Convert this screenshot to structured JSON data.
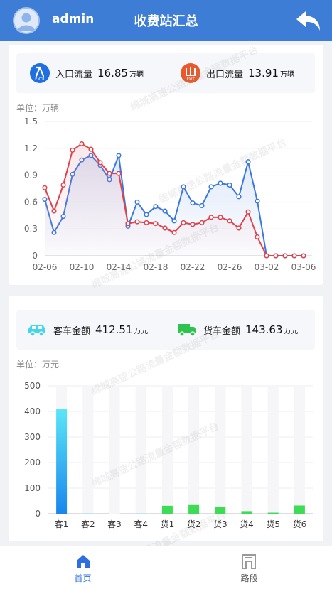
{
  "header": {
    "username": "admin",
    "title": "收费站汇总"
  },
  "watermark": "绵城高速公路流量金额数据平台",
  "traffic": {
    "entry_icon_text": "ENTR",
    "exit_icon_text": "EXIT",
    "entry_label": "入口流量",
    "entry_value": "16.85",
    "entry_unit": "万辆",
    "exit_label": "出口流量",
    "exit_value": "13.91",
    "exit_unit": "万辆",
    "unit_label": "单位：万辆",
    "accent_blue": "#3a78e0",
    "accent_red": "#e0414b"
  },
  "amount": {
    "car_label": "客车金额",
    "car_value": "412.51",
    "car_unit": "万元",
    "truck_label": "货车金额",
    "truck_value": "143.63",
    "truck_unit": "万元",
    "unit_label": "单位：万元"
  },
  "chart_data": [
    {
      "type": "line",
      "x": [
        "02-06",
        "02-07",
        "02-08",
        "02-09",
        "02-10",
        "02-11",
        "02-12",
        "02-13",
        "02-14",
        "02-15",
        "02-16",
        "02-17",
        "02-18",
        "02-19",
        "02-20",
        "02-21",
        "02-22",
        "02-23",
        "02-24",
        "02-25",
        "02-26",
        "02-27",
        "02-28",
        "03-01",
        "03-02",
        "03-03",
        "03-04",
        "03-05",
        "03-06"
      ],
      "x_ticks": [
        "02-06",
        "02-10",
        "02-14",
        "02-18",
        "02-22",
        "02-26",
        "03-02",
        "03-06"
      ],
      "y_ticks": [
        "0",
        "0.3",
        "0.6",
        "0.9",
        "1.2",
        "1.5"
      ],
      "ylim": [
        0,
        1.5
      ],
      "grid": true,
      "series": [
        {
          "color": "#3a78e0",
          "values": [
            0.63,
            0.26,
            0.44,
            0.91,
            1.07,
            1.12,
            1.01,
            0.85,
            1.12,
            0.33,
            0.6,
            0.46,
            0.55,
            0.5,
            0.39,
            0.77,
            0.59,
            0.56,
            0.77,
            0.81,
            0.79,
            0.66,
            1.05,
            0.61,
            0,
            0,
            0,
            0,
            0
          ]
        },
        {
          "color": "#e0414b",
          "values": [
            0.76,
            0.5,
            0.79,
            1.18,
            1.25,
            1.19,
            1.04,
            0.92,
            0.92,
            0.36,
            0.38,
            0.37,
            0.36,
            0.31,
            0.26,
            0.37,
            0.35,
            0.37,
            0.43,
            0.43,
            0.39,
            0.31,
            0.49,
            0.21,
            0,
            0,
            0,
            0,
            0
          ]
        }
      ]
    },
    {
      "type": "bar",
      "categories": [
        "客1",
        "客2",
        "客3",
        "客4",
        "货1",
        "货2",
        "货3",
        "货4",
        "货5",
        "货6"
      ],
      "values": [
        410,
        1,
        0,
        1,
        31,
        34,
        25,
        10,
        4,
        32
      ],
      "y_ticks": [
        "0",
        "100",
        "200",
        "300",
        "400",
        "500"
      ],
      "ylim": [
        0,
        500
      ],
      "grid": true,
      "colors": {
        "car": "#1aa0f0",
        "truck": "#3ddc55",
        "track": "#f6f6f8"
      }
    }
  ],
  "nav": {
    "home_label": "首页",
    "road_label": "路段",
    "active_color": "#2d6fe0",
    "inactive_color": "#555555"
  }
}
